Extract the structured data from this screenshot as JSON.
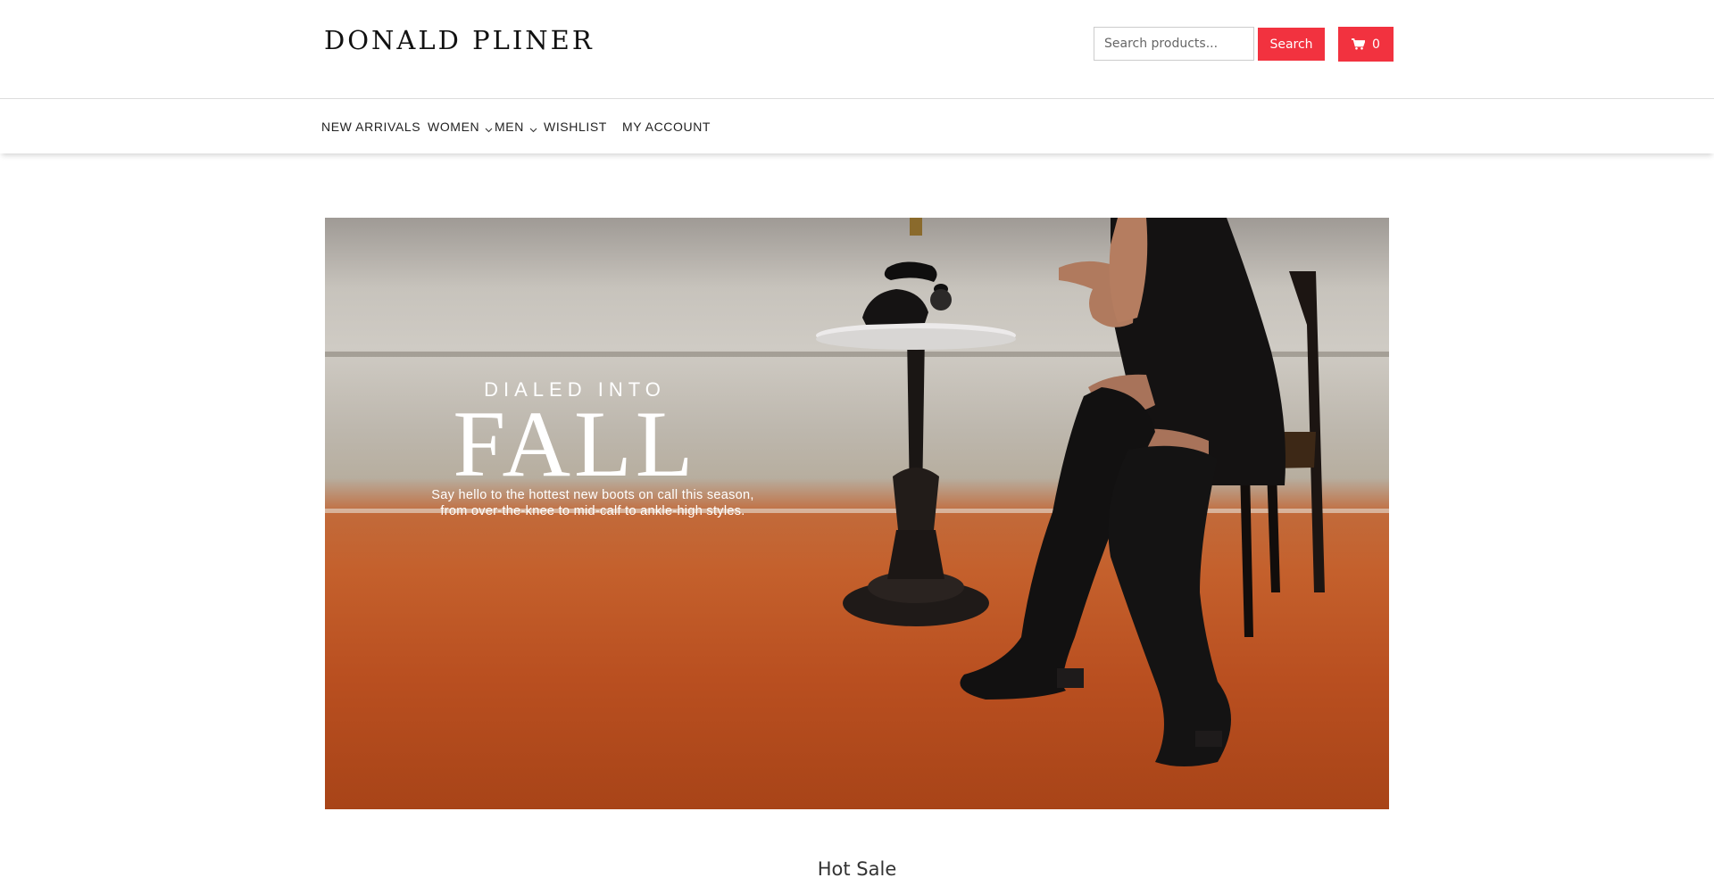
{
  "header": {
    "logo_text": "DONALD PLINER",
    "search": {
      "placeholder": "Search products...",
      "button_label": "Search"
    },
    "cart": {
      "count": "0",
      "icon": "cart-icon"
    }
  },
  "nav": {
    "items": [
      {
        "label": "NEW ARRIVALS",
        "has_dropdown": false
      },
      {
        "label": "WOMEN",
        "has_dropdown": true
      },
      {
        "label": "MEN",
        "has_dropdown": true
      },
      {
        "label": "WISHLIST",
        "has_dropdown": false
      },
      {
        "label": "MY ACCOUNT",
        "has_dropdown": false
      }
    ]
  },
  "hero": {
    "eyebrow": "DIALED INTO",
    "title": "FALL",
    "subtitle_line1": "Say hello to the hottest new boots on call this season,",
    "subtitle_line2": "from over-the-knee to mid-calf to ankle-high styles."
  },
  "sections": {
    "hot_sale_title": "Hot Sale"
  },
  "colors": {
    "accent": "#f2323f",
    "carpet": "#c4602c",
    "wall": "#cfcbc4"
  }
}
